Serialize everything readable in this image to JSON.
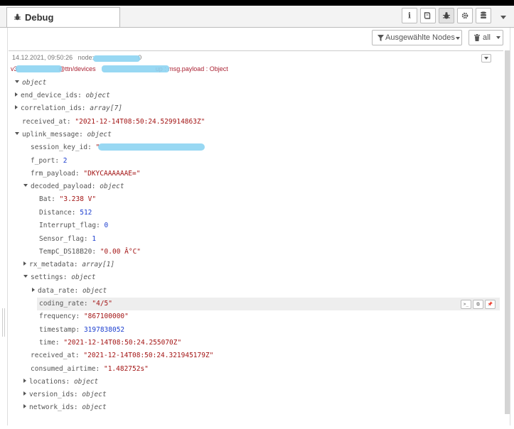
{
  "panel": {
    "title": "Debug",
    "active_tool": "debug-icon"
  },
  "toolbar": {
    "filter_label": "Ausgewählte Nodes",
    "clear_label": "all"
  },
  "message": {
    "timestamp": "14.12.2021, 09:50:26",
    "node_prefix": "node:",
    "node_suffix": "0",
    "topic_prefix": "v3",
    "topic_mid": "@ttn/devices",
    "topic_suffix": "up : msg.payload : Object"
  },
  "tree": {
    "root": "object",
    "end_device_ids": {
      "key": "end_device_ids",
      "type": "object"
    },
    "correlation_ids": {
      "key": "correlation_ids",
      "type": "array[7]"
    },
    "received_at": {
      "key": "received_at",
      "value": "\"2021-12-14T08:50:24.529914863Z\""
    },
    "uplink_message": {
      "key": "uplink_message",
      "type": "object"
    },
    "session_key_id": {
      "key": "session_key_id",
      "value": "\""
    },
    "f_port": {
      "key": "f_port",
      "value": "2"
    },
    "frm_payload": {
      "key": "frm_payload",
      "value": "\"DKYCAAAAAAE=\""
    },
    "decoded_payload": {
      "key": "decoded_payload",
      "type": "object"
    },
    "bat": {
      "key": "Bat",
      "value": "\"3.238 V\""
    },
    "distance": {
      "key": "Distance",
      "value": "512"
    },
    "interrupt_flag": {
      "key": "Interrupt_flag",
      "value": "0"
    },
    "sensor_flag": {
      "key": "Sensor_flag",
      "value": "1"
    },
    "tempc": {
      "key": "TempC_DS18B20",
      "value": "\"0.00 Â°C\""
    },
    "rx_metadata": {
      "key": "rx_metadata",
      "type": "array[1]"
    },
    "settings": {
      "key": "settings",
      "type": "object"
    },
    "data_rate": {
      "key": "data_rate",
      "type": "object"
    },
    "coding_rate": {
      "key": "coding_rate",
      "value": "\"4/5\""
    },
    "frequency": {
      "key": "frequency",
      "value": "\"867100000\""
    },
    "timestamp": {
      "key": "timestamp",
      "value": "3197838052"
    },
    "time": {
      "key": "time",
      "value": "\"2021-12-14T08:50:24.255070Z\""
    },
    "received_at_2": {
      "key": "received_at",
      "value": "\"2021-12-14T08:50:24.321945179Z\""
    },
    "consumed_airtime": {
      "key": "consumed_airtime",
      "value": "\"1.482752s\""
    },
    "locations": {
      "key": "locations",
      "type": "object"
    },
    "version_ids": {
      "key": "version_ids",
      "type": "object"
    },
    "network_ids": {
      "key": "network_ids",
      "type": "object"
    }
  },
  "row_tools": {
    "copy_path": ">_",
    "copy_value": "⧉",
    "pin": "📌"
  }
}
